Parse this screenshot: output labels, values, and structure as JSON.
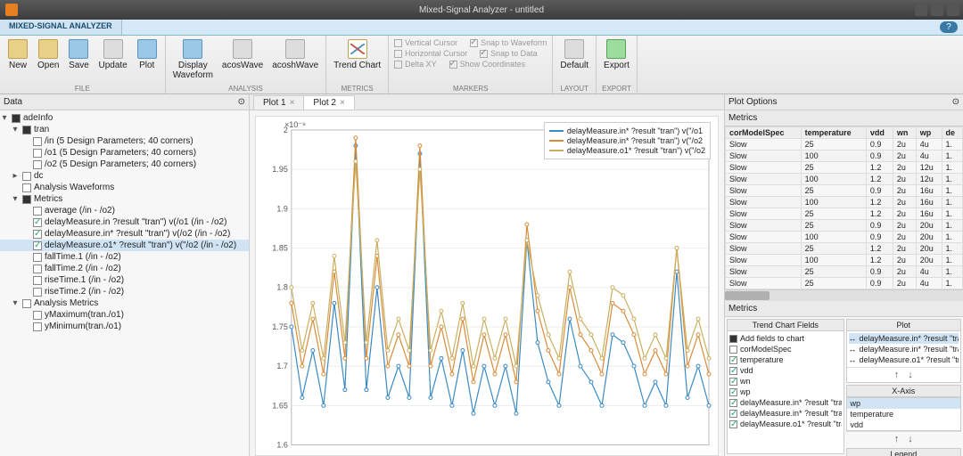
{
  "window": {
    "title": "Mixed-Signal Analyzer - untitled"
  },
  "ribbon_tab": "MIXED-SIGNAL ANALYZER",
  "ribbon": {
    "file": {
      "label": "FILE",
      "new": "New",
      "open": "Open",
      "save": "Save",
      "update": "Update",
      "plot": "Plot"
    },
    "analysis": {
      "label": "ANALYSIS",
      "displayWaveform": "Display\nWaveform",
      "acosWave": "acosWave",
      "acoshWave": "acoshWave"
    },
    "metrics": {
      "label": "METRICS",
      "trendChart": "Trend Chart"
    },
    "markers": {
      "label": "MARKERS",
      "verticalCursor": "Vertical Cursor",
      "snapWaveform": "Snap to Waveform",
      "horizontalCursor": "Horizontal Cursor",
      "snapData": "Snap to Data",
      "deltaXY": "Delta XY",
      "showCoordinates": "Show Coordinates"
    },
    "layout": {
      "label": "LAYOUT",
      "default": "Default"
    },
    "export": {
      "label": "EXPORT",
      "export": "Export"
    }
  },
  "data_panel": {
    "title": "Data",
    "root": "adeInfo",
    "tran": {
      "label": "tran",
      "in": "/in  (5 Design Parameters; 40 corners)",
      "o1": "/o1  (5 Design Parameters; 40 corners)",
      "o2": "/o2  (5 Design Parameters; 40 corners)"
    },
    "dc": "dc",
    "analysisWaveforms": "Analysis Waveforms",
    "metrics": {
      "label": "Metrics",
      "average": "average  (/in - /o2)",
      "dmIn": "delayMeasure.in  ?result \"tran\") v(/o1  (/in - /o2)",
      "dmIn2": "delayMeasure.in*  ?result \"tran\") v(/o2  (/in - /o2)",
      "dmO1": "delayMeasure.o1*  ?result \"tran\") v(\"/o2  (/in - /o2)",
      "fall1": "fallTime.1  (/in - /o2)",
      "fall2": "fallTime.2  (/in - /o2)",
      "rise1": "riseTime.1  (/in - /o2)",
      "rise2": "riseTime.2  (/in - /o2)"
    },
    "analysisMetrics": {
      "label": "Analysis Metrics",
      "ymax": "yMaximum(tran./o1)",
      "ymin": "yMinimum(tran./o1)"
    }
  },
  "plot": {
    "tab1": "Plot 1",
    "tab2": "Plot 2",
    "ylabel_exp": "×10⁻⁹",
    "legend": {
      "s1": "delayMeasure.in*  ?result \"tran\") v(\"/o1",
      "s2": "delayMeasure.in*  ?result \"tran\") v(\"/o2",
      "s3": "delayMeasure.o1*  ?result \"tran\") v(\"/o2"
    }
  },
  "right": {
    "tab": "Plot Options",
    "metricsTitle": "Metrics",
    "cols": {
      "c1": "corModelSpec",
      "c2": "temperature",
      "c3": "vdd",
      "c4": "wn",
      "c5": "wp",
      "c6": "de"
    },
    "rows": [
      {
        "c1": "Slow",
        "c2": "25",
        "c3": "0.9",
        "c4": "2u",
        "c5": "4u",
        "c6": "1."
      },
      {
        "c1": "Slow",
        "c2": "100",
        "c3": "0.9",
        "c4": "2u",
        "c5": "4u",
        "c6": "1."
      },
      {
        "c1": "Slow",
        "c2": "25",
        "c3": "1.2",
        "c4": "2u",
        "c5": "12u",
        "c6": "1."
      },
      {
        "c1": "Slow",
        "c2": "100",
        "c3": "1.2",
        "c4": "2u",
        "c5": "12u",
        "c6": "1."
      },
      {
        "c1": "Slow",
        "c2": "25",
        "c3": "0.9",
        "c4": "2u",
        "c5": "16u",
        "c6": "1."
      },
      {
        "c1": "Slow",
        "c2": "100",
        "c3": "1.2",
        "c4": "2u",
        "c5": "16u",
        "c6": "1."
      },
      {
        "c1": "Slow",
        "c2": "25",
        "c3": "1.2",
        "c4": "2u",
        "c5": "16u",
        "c6": "1."
      },
      {
        "c1": "Slow",
        "c2": "25",
        "c3": "0.9",
        "c4": "2u",
        "c5": "20u",
        "c6": "1."
      },
      {
        "c1": "Slow",
        "c2": "100",
        "c3": "0.9",
        "c4": "2u",
        "c5": "20u",
        "c6": "1."
      },
      {
        "c1": "Slow",
        "c2": "25",
        "c3": "1.2",
        "c4": "2u",
        "c5": "20u",
        "c6": "1."
      },
      {
        "c1": "Slow",
        "c2": "100",
        "c3": "1.2",
        "c4": "2u",
        "c5": "20u",
        "c6": "1."
      },
      {
        "c1": "Slow",
        "c2": "25",
        "c3": "0.9",
        "c4": "2u",
        "c5": "4u",
        "c6": "1."
      },
      {
        "c1": "Slow",
        "c2": "25",
        "c3": "0.9",
        "c4": "2u",
        "c5": "4u",
        "c6": "1."
      }
    ],
    "trendFields": {
      "title": "Trend Chart Fields",
      "addLabel": "Add fields to chart",
      "corModelSpec": "corModelSpec",
      "temperature": "temperature",
      "vdd": "vdd",
      "wn": "wn",
      "wp": "wp",
      "dmIn": "delayMeasure.in*  ?result \"tran\"",
      "dmIn2": "delayMeasure.in*  ?result \"tran\"",
      "dmO1": "delayMeasure.o1*  ?result \"tran\""
    },
    "plotBox": {
      "title": "Plot",
      "l1": "delayMeasure.in*  ?result \"tran\") v(\"/o1",
      "l2": "delayMeasure.in*  ?result \"tran\") v(\"/o2",
      "l3": "delayMeasure.o1*  ?result \"tran\") v(\"/o2"
    },
    "xaxis": {
      "title": "X-Axis",
      "wp": "wp",
      "temperature": "temperature",
      "vdd": "vdd"
    },
    "legendTitle": "Legend"
  },
  "chart_data": {
    "type": "line",
    "title": "",
    "ylabel": "×10⁻⁹",
    "ylim": [
      1.6,
      2.0
    ],
    "yticks": [
      1.6,
      1.65,
      1.7,
      1.75,
      1.8,
      1.85,
      1.9,
      1.95,
      2.0
    ],
    "n_points": 40,
    "series": [
      {
        "name": "delayMeasure.in* ?result \"tran\") v(\"/o1",
        "color": "#3b8ac4",
        "values": [
          1.75,
          1.66,
          1.72,
          1.65,
          1.78,
          1.67,
          1.98,
          1.67,
          1.8,
          1.66,
          1.7,
          1.66,
          1.97,
          1.66,
          1.71,
          1.65,
          1.72,
          1.64,
          1.7,
          1.65,
          1.7,
          1.64,
          1.86,
          1.73,
          1.68,
          1.65,
          1.76,
          1.7,
          1.68,
          1.65,
          1.74,
          1.73,
          1.7,
          1.65,
          1.68,
          1.65,
          1.82,
          1.66,
          1.7,
          1.65
        ]
      },
      {
        "name": "delayMeasure.in* ?result \"tran\") v(\"/o2",
        "color": "#d98c3a",
        "values": [
          1.78,
          1.7,
          1.76,
          1.69,
          1.82,
          1.71,
          1.99,
          1.71,
          1.84,
          1.7,
          1.74,
          1.7,
          1.98,
          1.7,
          1.75,
          1.69,
          1.76,
          1.68,
          1.74,
          1.69,
          1.74,
          1.68,
          1.88,
          1.77,
          1.72,
          1.69,
          1.8,
          1.74,
          1.72,
          1.69,
          1.78,
          1.77,
          1.74,
          1.69,
          1.72,
          1.69,
          1.85,
          1.7,
          1.74,
          1.69
        ]
      },
      {
        "name": "delayMeasure.o1* ?result \"tran\") v(\"/o2",
        "color": "#c9b060",
        "values": [
          1.8,
          1.72,
          1.78,
          1.71,
          1.84,
          1.73,
          1.96,
          1.73,
          1.86,
          1.72,
          1.76,
          1.72,
          1.95,
          1.72,
          1.77,
          1.71,
          1.78,
          1.7,
          1.76,
          1.71,
          1.76,
          1.7,
          1.86,
          1.79,
          1.74,
          1.71,
          1.82,
          1.76,
          1.74,
          1.71,
          1.8,
          1.79,
          1.76,
          1.71,
          1.74,
          1.71,
          1.85,
          1.72,
          1.76,
          1.71
        ]
      }
    ]
  }
}
